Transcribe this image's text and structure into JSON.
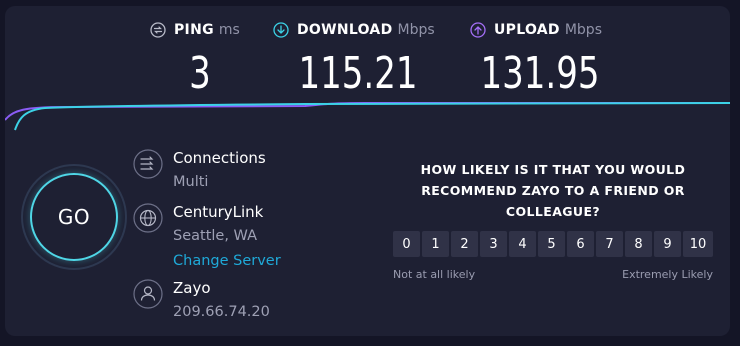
{
  "metrics": {
    "ping": {
      "label": "PING",
      "unit": "ms",
      "value": "3"
    },
    "download": {
      "label": "DOWNLOAD",
      "unit": "Mbps",
      "value": "115.21"
    },
    "upload": {
      "label": "UPLOAD",
      "unit": "Mbps",
      "value": "131.95"
    }
  },
  "colors": {
    "download": "#3cd2e6",
    "upload": "#8a5cf5",
    "accent": "#1fa9d8"
  },
  "go_button": {
    "label": "GO"
  },
  "connections": {
    "title": "Connections",
    "value": "Multi",
    "icon": "connections-arrows-icon"
  },
  "server": {
    "name": "CenturyLink",
    "location": "Seattle, WA",
    "change_label": "Change Server",
    "icon": "globe-icon"
  },
  "provider": {
    "name": "Zayo",
    "ip": "209.66.74.20",
    "icon": "user-icon"
  },
  "survey": {
    "question": "HOW LIKELY IS IT THAT YOU WOULD RECOMMEND ZAYO TO A FRIEND OR COLLEAGUE?",
    "scale": [
      "0",
      "1",
      "2",
      "3",
      "4",
      "5",
      "6",
      "7",
      "8",
      "9",
      "10"
    ],
    "low_label": "Not at all likely",
    "high_label": "Extremely Likely"
  }
}
